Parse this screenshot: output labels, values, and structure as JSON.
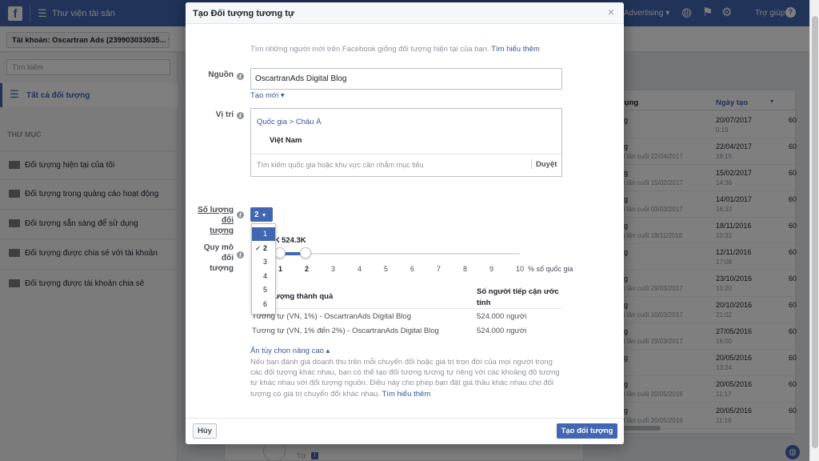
{
  "app": {
    "title": "Thư viện tài sản",
    "advertising": "Advertising",
    "help": "Trợ giúp",
    "account": "Tài khoản: Oscartran Ads (239903033035..."
  },
  "sidebar": {
    "search_placeholder": "Tìm kiếm",
    "all_audiences": "Tất cả đối tượng",
    "folder_heading": "THƯ MỤC",
    "folders": [
      "Đối tượng hiện tại của tôi",
      "Đối tượng trong quảng cáo hoạt động",
      "Đối tượng sẵn sàng để sử dụng",
      "Đối tượng được chia sẻ với tài khoản",
      "Đối tượng được tài khoản chia sẻ"
    ]
  },
  "background_table": {
    "col_usage": "dụng",
    "col_created": "Ngày tạo",
    "rows": [
      {
        "c1": "ng",
        "c1b": "",
        "date": "20/07/2017",
        "time": "0:19",
        "c3": "60"
      },
      {
        "c1": "ng",
        "c1b": "ật lần cuối 22/04/2017",
        "date": "22/04/2017",
        "time": "19:15",
        "c3": "60"
      },
      {
        "c1": "ng",
        "c1b": "ật lần cuối 15/02/2017",
        "date": "15/02/2017",
        "time": "14:36",
        "c3": "60"
      },
      {
        "c1": "ng",
        "c1b": "ật lần cuối 03/03/2017",
        "date": "14/01/2017",
        "time": "16:33",
        "c3": "60"
      },
      {
        "c1": "ng",
        "c1b": "ật lần cuối 18/11/2016",
        "date": "18/11/2016",
        "time": "10:32",
        "c3": "60"
      },
      {
        "c1": "ng",
        "c1b": "",
        "date": "12/11/2016",
        "time": "17:08",
        "c3": "60"
      },
      {
        "c1": "ng",
        "c1b": "ật lần cuối 29/03/2017",
        "date": "23/10/2016",
        "time": "10:20",
        "c3": "60"
      },
      {
        "c1": "ng",
        "c1b": "ật lần cuối 10/03/2017",
        "date": "20/10/2016",
        "time": "21:02",
        "c3": "60"
      },
      {
        "c1": "ng",
        "c1b": "ật lần cuối 29/03/2017",
        "date": "27/05/2016",
        "time": "16:00",
        "c3": "60"
      },
      {
        "c1": "ng",
        "c1b": "",
        "date": "20/05/2016",
        "time": "13:24",
        "c3": "60"
      },
      {
        "c1": "ng",
        "c1b": "ật lần cuối 20/05/2016",
        "date": "20/05/2016",
        "time": "11:17",
        "c3": "60"
      },
      {
        "c1": "ng",
        "c1b": "ật lần cuối 20/05/2016",
        "date": "20/05/2016",
        "time": "11:16",
        "c3": "60"
      }
    ],
    "from_label": "Từ"
  },
  "modal": {
    "title": "Tạo Đối tượng tương tự",
    "close": "×",
    "intro": "Tìm những người mới trên Facebook giống đối tượng hiện tại của bạn.",
    "learn_more": "Tìm hiểu thêm",
    "source_label": "Nguồn",
    "source_value": "OscartranAds Digital Blog",
    "create_new": "Tạo mới",
    "location_label": "Vị trí",
    "location_breadcrumb": "Quốc gia > Châu Á",
    "location_country": "Việt Nam",
    "location_search_placeholder": "Tìm kiếm quốc gia hoặc khu vực cần nhắm mục tiêu",
    "browse": "Duyệt",
    "count_label_1": "Số lượng",
    "count_label_2": "đối tượng",
    "count_value": "2",
    "dropdown_options": [
      "1",
      "2",
      "3",
      "4",
      "5",
      "6"
    ],
    "dropdown_selected": "2",
    "dropdown_highlighted": "1",
    "size_label_1": "Quy mô đối",
    "size_label_2": "tượng",
    "reach_prefix": "K",
    "reach_value": "524.3K",
    "slider_ticks": [
      "1",
      "2",
      "3",
      "4",
      "5",
      "6",
      "7",
      "8",
      "9",
      "10"
    ],
    "slider_value_range": [
      1,
      2
    ],
    "slider_unit": "% số quốc gia",
    "table_col1": "ượng thành quả",
    "table_col2": "Số người tiếp cận ước tính",
    "table_rows": [
      {
        "name": "Tương tự (VN, 1%) - OscartranAds Digital Blog",
        "reach": "524.000 người"
      },
      {
        "name": "Tương tự (VN, 1% đến 2%) - OscartranAds Digital Blog",
        "reach": "524.000 người"
      }
    ],
    "advanced_toggle": "Ẩn tùy chọn nâng cao",
    "advanced_text": "Nếu bạn đánh giá doanh thu trên mỗi chuyển đổi hoặc giá trị trọn đời của mọi người trong các đối tượng khác nhau, bạn có thể tạo đối tượng tương tự riêng với các khoảng độ tương tự khác nhau với đối tượng nguồn. Điều này cho phép bạn đặt giá thầu khác nhau cho đối tượng có giá trị chuyển đổi khác nhau.",
    "advanced_learn_more": "Tìm hiểu thêm",
    "cancel": "Hủy",
    "create": "Tạo đối tượng"
  },
  "colors": {
    "brand": "#4267b2",
    "link": "#365899"
  },
  "icons": [
    "facebook-logo-icon",
    "menu-icon",
    "globe-icon",
    "flag-icon",
    "gear-icon",
    "help-icon",
    "list-icon",
    "folder-icon",
    "info-icon",
    "close-icon",
    "check-icon",
    "caret-down-icon",
    "caret-up-icon"
  ]
}
